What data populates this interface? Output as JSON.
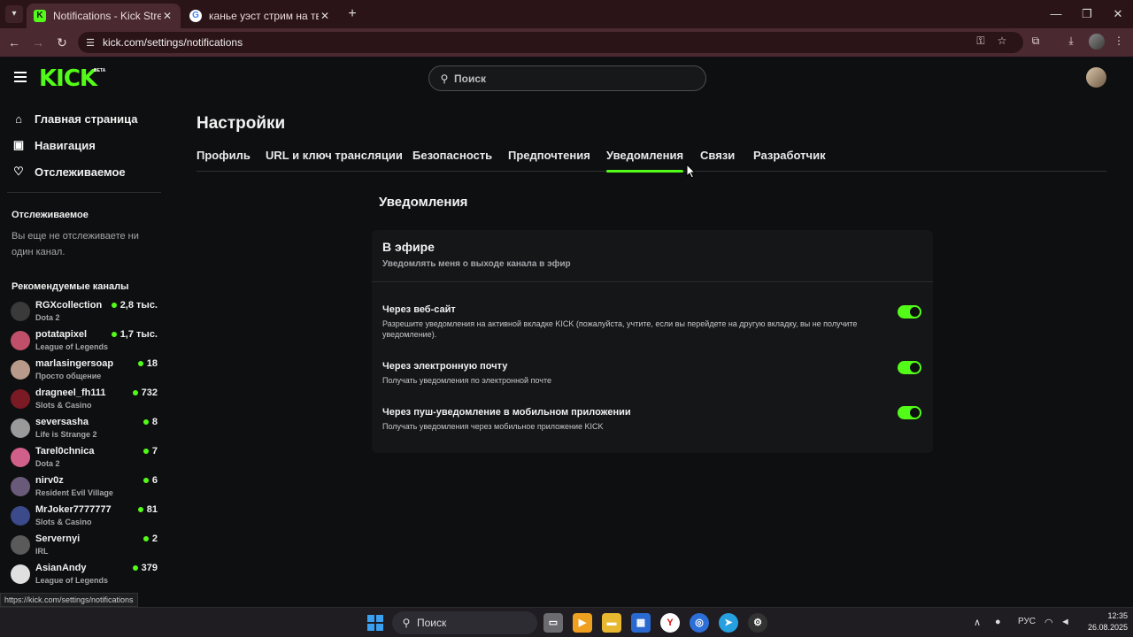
{
  "browser": {
    "tabs": [
      {
        "title": "Notifications - Kick Streaming",
        "favicon": "kick-favicon",
        "active": true
      },
      {
        "title": "канье уэст стрим на твиче - П",
        "favicon": "google-favicon",
        "active": false
      }
    ],
    "url": "kick.com/settings/notifications",
    "status_url": "https://kick.com/settings/notifications"
  },
  "header": {
    "logo": "KICK",
    "logo_badge": "BETA",
    "search_placeholder": "Поиск"
  },
  "sidebar": {
    "nav": [
      {
        "label": "Главная страница",
        "icon": "home-icon"
      },
      {
        "label": "Навигация",
        "icon": "browse-icon"
      },
      {
        "label": "Отслеживаемое",
        "icon": "heart-icon"
      }
    ],
    "following_heading": "Отслеживаемое",
    "following_empty": "Вы еще не отслеживаете ни один канал.",
    "recommended_heading": "Рекомендуемые каналы",
    "channels": [
      {
        "name": "RGXcollection",
        "category": "Dota 2",
        "viewers": "2,8 тыс.",
        "color": "#3a3a3a"
      },
      {
        "name": "potatapixel",
        "category": "League of Legends",
        "viewers": "1,7 тыс.",
        "color": "#c0506a"
      },
      {
        "name": "marlasingersoap",
        "category": "Просто общение",
        "viewers": "18",
        "color": "#b89a8a"
      },
      {
        "name": "dragneel_fh111",
        "category": "Slots & Casino",
        "viewers": "732",
        "color": "#7a1a24"
      },
      {
        "name": "seversasha",
        "category": "Life is Strange 2",
        "viewers": "8",
        "color": "#9a9a9a"
      },
      {
        "name": "Tarel0chnica",
        "category": "Dota 2",
        "viewers": "7",
        "color": "#d0608a"
      },
      {
        "name": "nirv0z",
        "category": "Resident Evil Village",
        "viewers": "6",
        "color": "#6a5a7a"
      },
      {
        "name": "MrJoker7777777",
        "category": "Slots & Casino",
        "viewers": "81",
        "color": "#3a4a8a"
      },
      {
        "name": "Servernyi",
        "category": "IRL",
        "viewers": "2",
        "color": "#5a5a5a"
      },
      {
        "name": "AsianAndy",
        "category": "League of Legends",
        "viewers": "379",
        "color": "#e0e0e0"
      }
    ]
  },
  "main": {
    "title": "Настройки",
    "tabs": [
      "Профиль",
      "URL и ключ трансляции",
      "Безопасность",
      "Предпочтения",
      "Уведомления",
      "Связи",
      "Разработчик"
    ],
    "active_tab": "Уведомления",
    "section_title": "Уведомления",
    "card": {
      "title": "В эфире",
      "subtitle": "Уведомлять меня о выходе канала в эфир",
      "options": [
        {
          "title": "Через веб-сайт",
          "description": "Разрешите уведомления на активной вкладке KICK (пожалуйста, учтите, если вы перейдете на другую вкладку, вы не получите уведомление).",
          "enabled": true
        },
        {
          "title": "Через электронную почту",
          "description": "Получать уведомления по электронной почте",
          "enabled": true
        },
        {
          "title": "Через пуш-уведомление в мобильном приложении",
          "description": "Получать уведомления через мобильное приложение KICK",
          "enabled": true
        }
      ]
    }
  },
  "taskbar": {
    "search_label": "Поиск",
    "language": "РУС",
    "time": "12:35",
    "date": "26.08.2025"
  },
  "colors": {
    "accent": "#53fc18",
    "background": "#0e0f10",
    "card": "#151618"
  }
}
